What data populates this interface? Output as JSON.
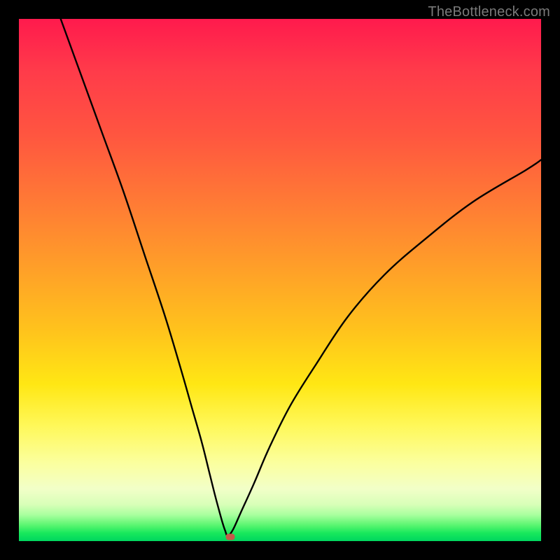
{
  "watermark": "TheBottleneck.com",
  "chart_data": {
    "type": "line",
    "title": "",
    "xlabel": "",
    "ylabel": "",
    "xlim": [
      0,
      100
    ],
    "ylim": [
      0,
      100
    ],
    "grid": false,
    "legend": false,
    "series": [
      {
        "name": "bottleneck-curve",
        "x": [
          8,
          12,
          16,
          20,
          24,
          28,
          31,
          33,
          35,
          36.5,
          37.5,
          38.3,
          39,
          39.5,
          40,
          41,
          42.5,
          45,
          48,
          52,
          57,
          63,
          70,
          78,
          87,
          97,
          100
        ],
        "y": [
          100,
          89,
          78,
          67,
          55,
          43,
          33,
          26,
          19,
          13,
          9,
          6,
          3.5,
          2,
          1,
          2.2,
          5.5,
          11,
          18,
          26,
          34,
          43,
          51,
          58,
          65,
          71,
          73
        ]
      }
    ],
    "marker": {
      "x": 40.5,
      "y": 0.8,
      "color": "#c55a4a"
    },
    "gradient_stops": [
      {
        "pct": 0,
        "color": "#ff1a4d"
      },
      {
        "pct": 10,
        "color": "#ff3b4a"
      },
      {
        "pct": 22,
        "color": "#ff5540"
      },
      {
        "pct": 35,
        "color": "#ff7a35"
      },
      {
        "pct": 48,
        "color": "#ffa028"
      },
      {
        "pct": 60,
        "color": "#ffc41c"
      },
      {
        "pct": 70,
        "color": "#ffe714"
      },
      {
        "pct": 78,
        "color": "#fff85a"
      },
      {
        "pct": 85,
        "color": "#fbff9e"
      },
      {
        "pct": 90,
        "color": "#f2ffc8"
      },
      {
        "pct": 93,
        "color": "#d8ffb8"
      },
      {
        "pct": 95,
        "color": "#a8ff9e"
      },
      {
        "pct": 97,
        "color": "#58f56f"
      },
      {
        "pct": 98.5,
        "color": "#17e85c"
      },
      {
        "pct": 100,
        "color": "#00d65e"
      }
    ]
  }
}
